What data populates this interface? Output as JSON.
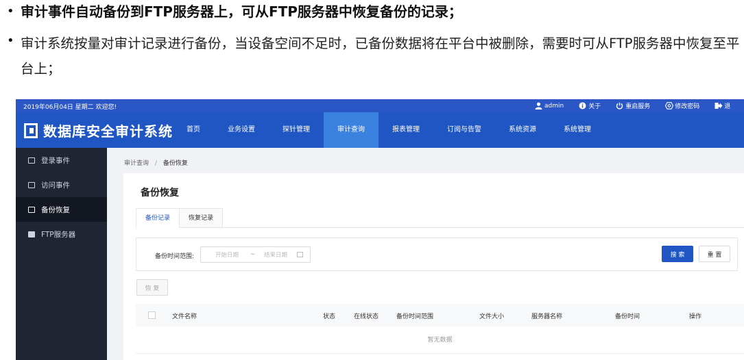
{
  "slide": {
    "bullet1": "审计事件自动备份到FTP服务器上，可从FTP服务器中恢复备份的记录；",
    "bullet2": "审计系统按量对审计记录进行备份，当设备空间不足时，已备份数据将在平台中被删除，需要时可从FTP服务器中恢复至平台上；",
    "bullet_mark": "•"
  },
  "topbar": {
    "date": "2019年06月04日 星期二 欢迎您!",
    "user": "admin",
    "about": "关于",
    "restart": "重启服务",
    "change_password": "修改密码",
    "logout": "退"
  },
  "app": {
    "name": "数据库安全审计系统",
    "brand_color": "#1f56c4",
    "nav": [
      {
        "label": "首页"
      },
      {
        "label": "业务设置"
      },
      {
        "label": "探针管理"
      },
      {
        "label": "审计查询"
      },
      {
        "label": "报表管理"
      },
      {
        "label": "订阅与告警"
      },
      {
        "label": "系统资源"
      },
      {
        "label": "系统管理"
      }
    ],
    "nav_active": "审计查询"
  },
  "sidebar": {
    "items": [
      {
        "label": "登录事件",
        "icon": "login-event-icon"
      },
      {
        "label": "访问事件",
        "icon": "access-event-icon"
      },
      {
        "label": "备份恢复",
        "icon": "backup-icon"
      },
      {
        "label": "FTP服务器",
        "icon": "ftp-server-icon"
      }
    ],
    "active": "备份恢复"
  },
  "breadcrumb": {
    "parent": "审计查询",
    "separator": "/",
    "current": "备份恢复"
  },
  "page": {
    "title": "备份恢复",
    "tabs": [
      {
        "label": "备份记录"
      },
      {
        "label": "恢复记录"
      }
    ],
    "active_tab": "备份记录"
  },
  "search": {
    "label": "备份时间范围:",
    "start_placeholder": "开始日期",
    "separator": "~",
    "end_placeholder": "结束日期",
    "search_button": "搜 索",
    "reset_button": "重 置"
  },
  "actions": {
    "restore_button": "恢 复"
  },
  "table": {
    "columns": [
      "文件名称",
      "状态",
      "在线状态",
      "备份时间范围",
      "文件大小",
      "服务器名称",
      "备份时间",
      "操作"
    ],
    "empty_text": "暂无数据"
  }
}
